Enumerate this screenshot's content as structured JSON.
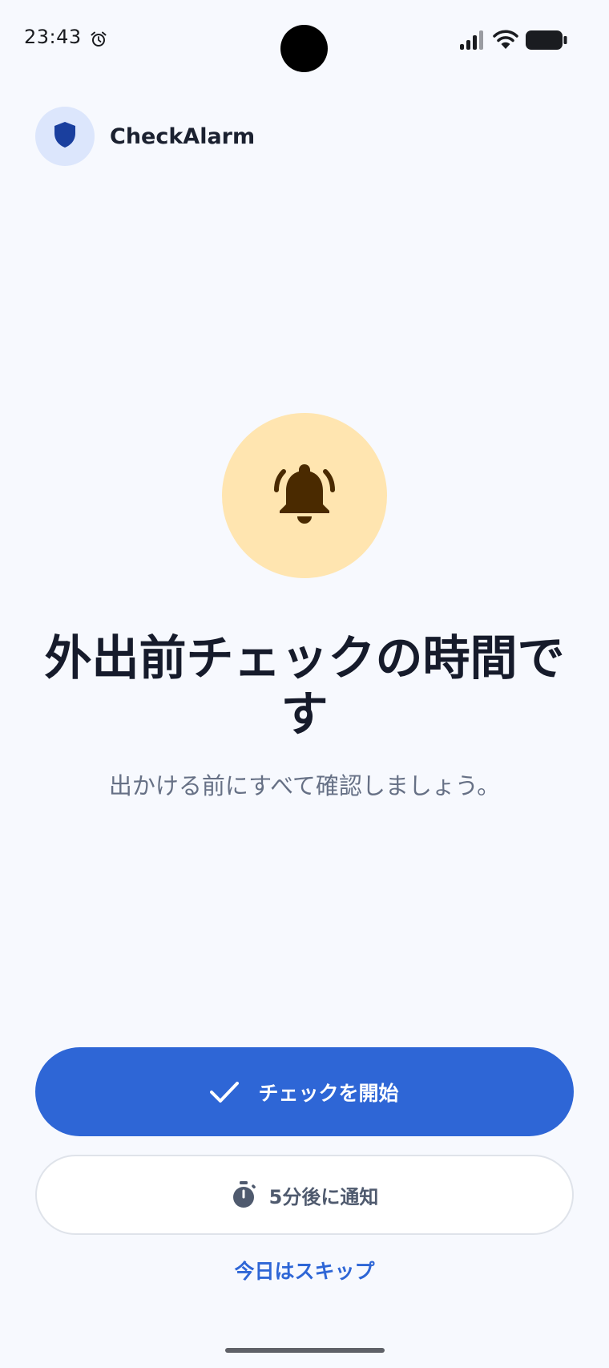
{
  "status_bar": {
    "time": "23:43",
    "icons": [
      "alarm-icon",
      "signal-icon",
      "wifi-icon",
      "battery-icon"
    ]
  },
  "header": {
    "app_name": "CheckAlarm",
    "logo_icon": "shield-icon"
  },
  "hero": {
    "icon": "bell-ringing-icon",
    "title": "外出前チェックの時間です",
    "subtitle": "出かける前にすべて確認しましょう。"
  },
  "actions": {
    "start_label": "チェックを開始",
    "start_icon": "check-icon",
    "snooze_label": "5分後に通知",
    "snooze_icon": "stopwatch-icon",
    "skip_label": "今日はスキップ"
  },
  "colors": {
    "background": "#f7f9fe",
    "primary": "#2e66d6",
    "logo_bg": "#dce6fc",
    "logo_shield": "#1a3f9e",
    "bell_bg": "#ffe5b0",
    "bell": "#4a2a00",
    "title": "#161b2b",
    "subtitle": "#667085"
  }
}
